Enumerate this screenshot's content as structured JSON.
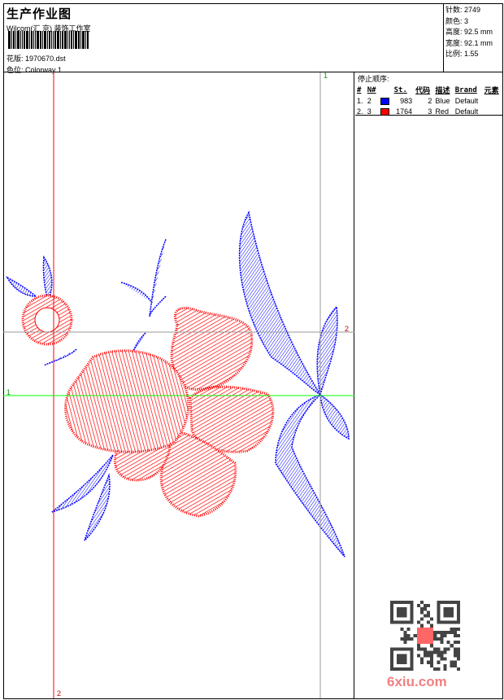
{
  "header": {
    "title": "生产作业图",
    "company": "Wilcom(汇 京) 装饰工作室",
    "pattern_label": "花版:",
    "pattern_value": "1970670.dst",
    "colorway_label": "色位:",
    "colorway_value": "Colorway 1"
  },
  "stats": [
    {
      "label": "针数:",
      "value": "2749"
    },
    {
      "label": "颜色:",
      "value": "3"
    },
    {
      "label": "高度:",
      "value": "92.5 mm"
    },
    {
      "label": "宽度:",
      "value": "92.1 mm"
    },
    {
      "label": "比例:",
      "value": "1.55"
    }
  ],
  "stop_sequence": {
    "caption": "停止顺序:",
    "headers": [
      "#",
      "N#",
      "",
      "St.",
      "代码",
      "描述",
      "Brand",
      "元素"
    ],
    "rows": [
      {
        "index": "1.",
        "n": "2",
        "color": "#0000ff",
        "stitches": "983",
        "code": "2",
        "desc": "Blue",
        "brand": "Default"
      },
      {
        "index": "2.",
        "n": "3",
        "color": "#ff0000",
        "stitches": "1764",
        "code": "3",
        "desc": "Red",
        "brand": "Default"
      }
    ]
  },
  "guides": {
    "v_green": "1",
    "h_red": "2",
    "h_green": "1",
    "v_red": "2"
  },
  "watermark": "6xiu.com",
  "colors": {
    "red": "#ff0000",
    "blue": "#0000ff",
    "green": "#00ff00"
  }
}
